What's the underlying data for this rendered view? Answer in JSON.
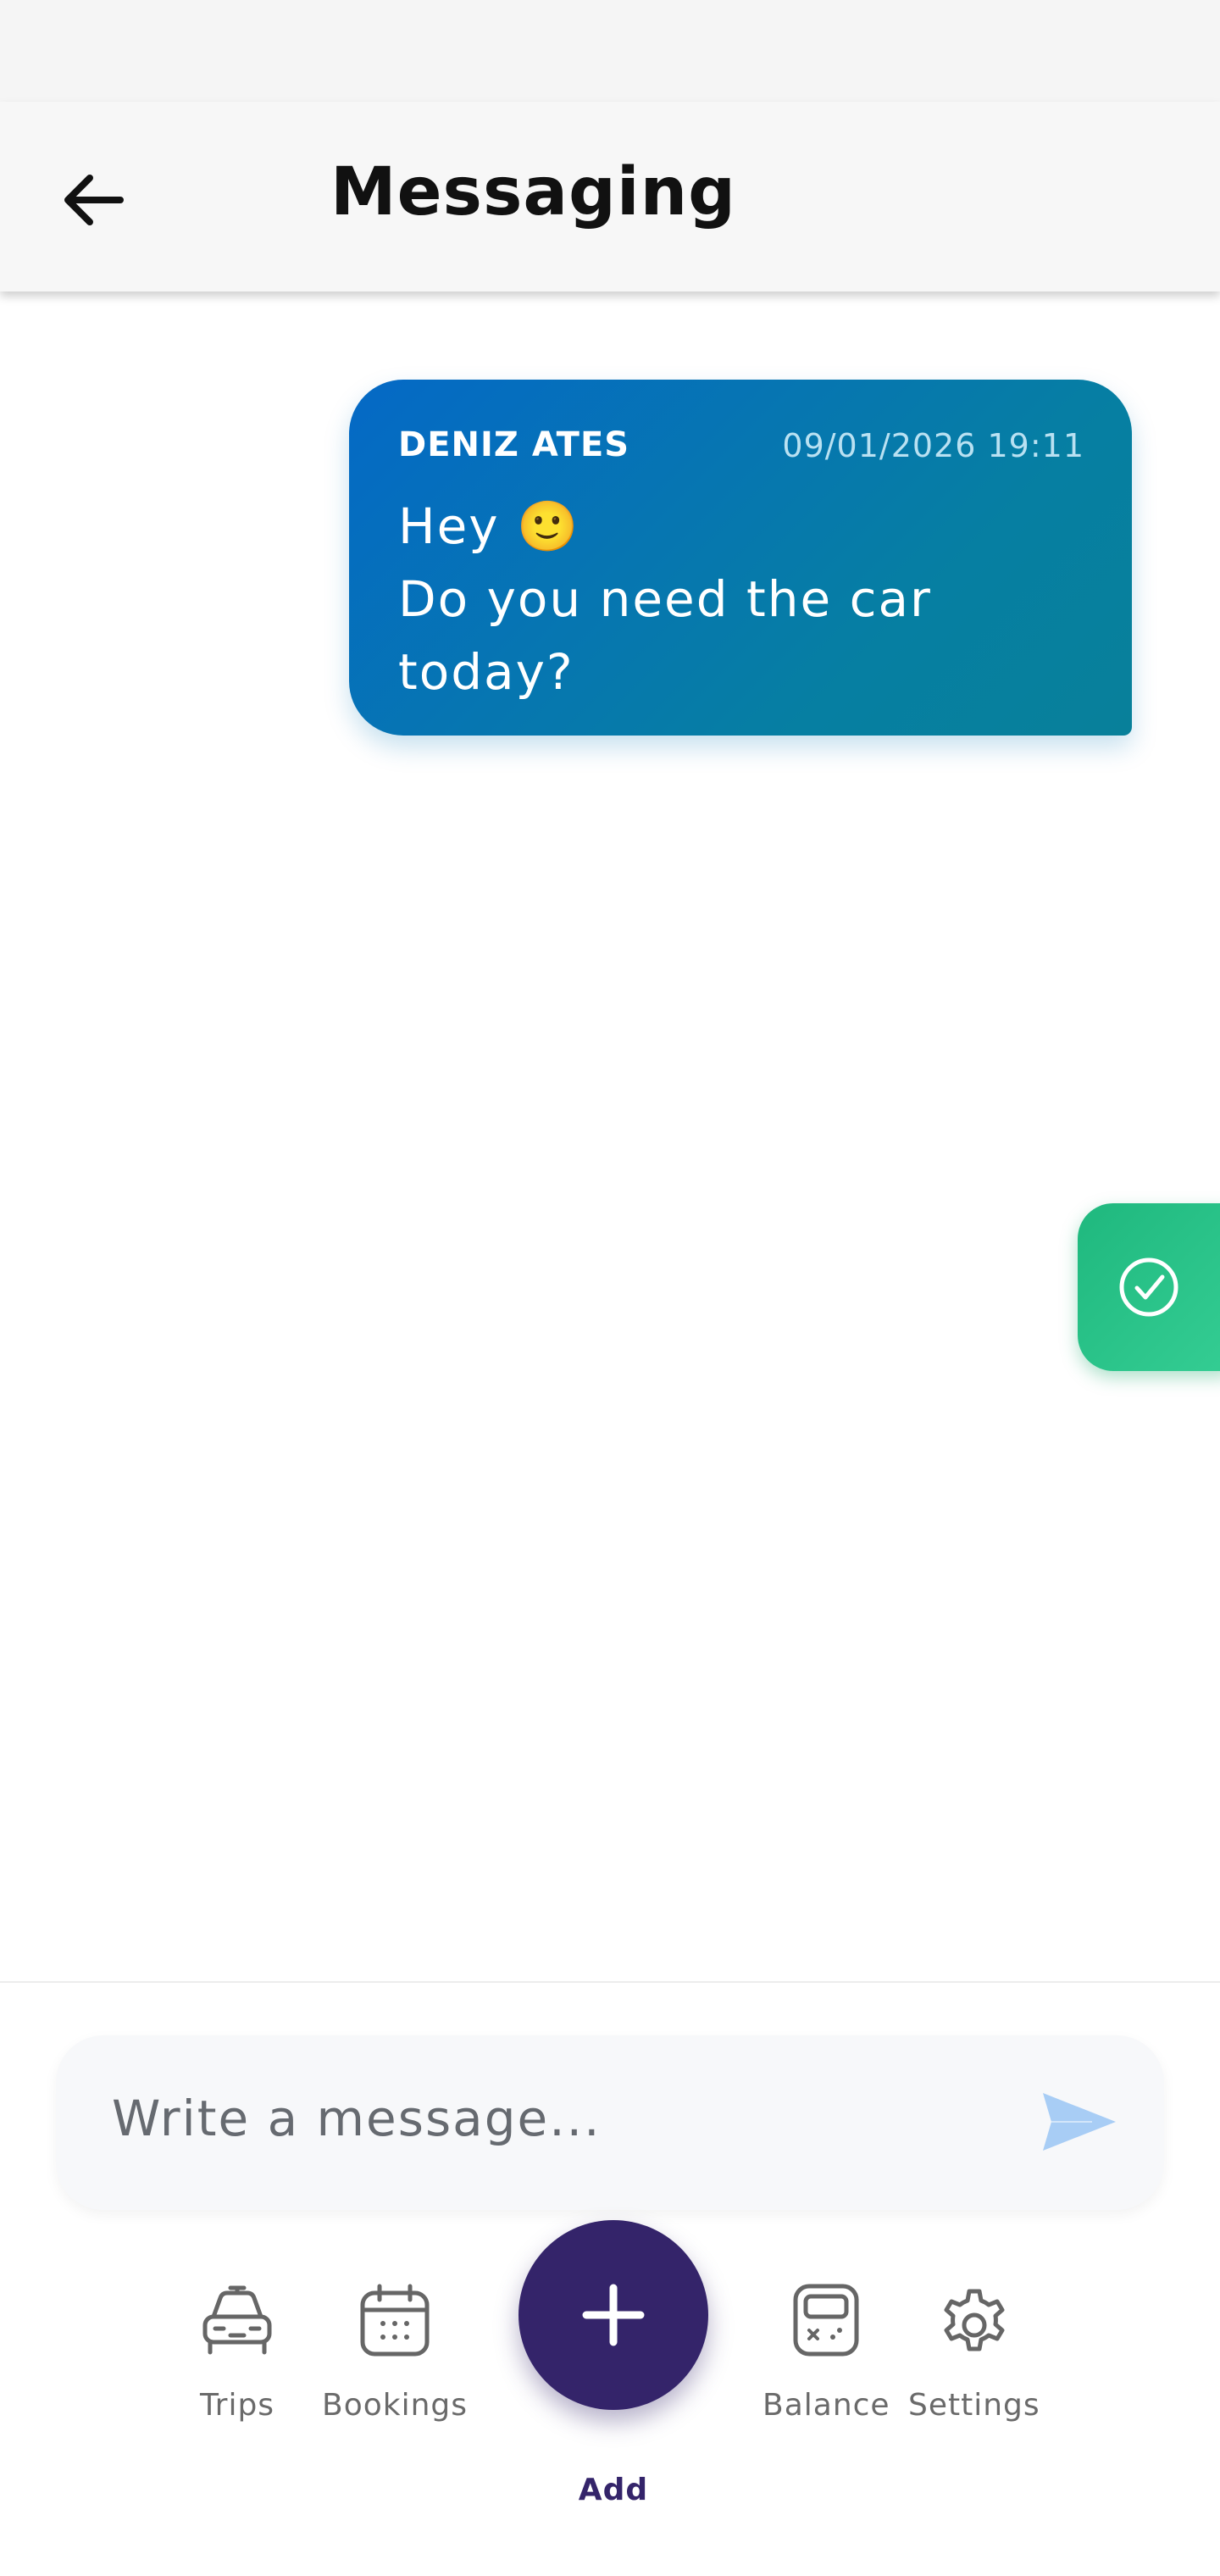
{
  "header": {
    "title": "Messaging",
    "back_icon": "arrow-left-icon"
  },
  "messages": [
    {
      "sender": "DENIZ ATES",
      "timestamp": "09/01/2026 19:11",
      "text": " Hey 🙂\nDo you need the car today?"
    }
  ],
  "confirm_button": {
    "icon": "check-circle-icon",
    "color": "#2cc58b"
  },
  "composer": {
    "placeholder": "Write a message...",
    "send_icon": "send-icon",
    "send_color": "#a8cdf5"
  },
  "bottom_nav": {
    "items": [
      {
        "label": "Trips",
        "icon": "car-icon"
      },
      {
        "label": "Bookings",
        "icon": "calendar-icon"
      },
      {
        "label": "Balance",
        "icon": "calculator-icon"
      },
      {
        "label": "Settings",
        "icon": "gear-icon"
      }
    ],
    "add": {
      "label": "Add",
      "icon": "plus-icon",
      "color": "#34246a"
    }
  },
  "colors": {
    "bubble_gradient_start": "#0569c6",
    "bubble_gradient_end": "#08809a"
  }
}
